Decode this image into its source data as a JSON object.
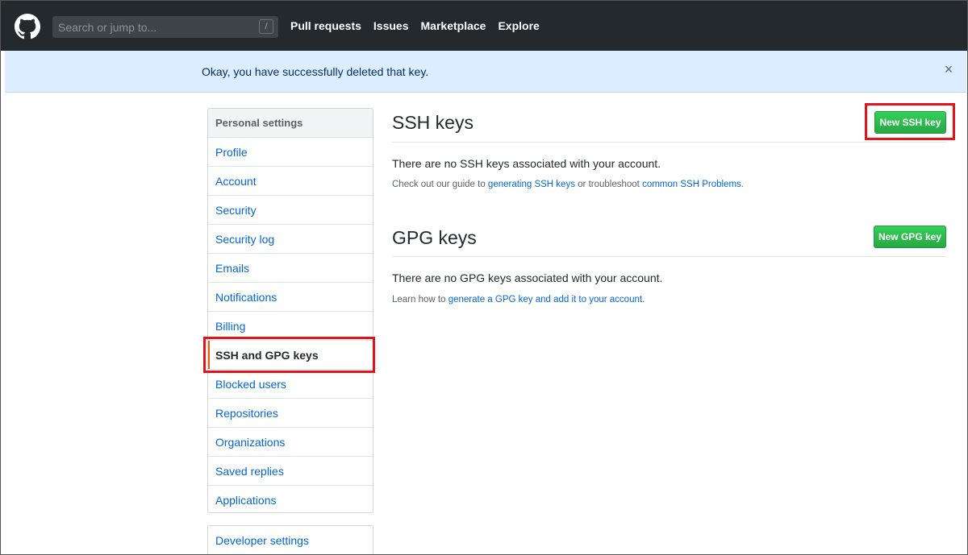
{
  "header": {
    "search_placeholder": "Search or jump to...",
    "search_shortcut": "/",
    "nav": [
      "Pull requests",
      "Issues",
      "Marketplace",
      "Explore"
    ]
  },
  "flash": {
    "message": "Okay, you have successfully deleted that key.",
    "close": "×"
  },
  "sidebar": {
    "heading": "Personal settings",
    "items": [
      {
        "label": "Profile"
      },
      {
        "label": "Account"
      },
      {
        "label": "Security"
      },
      {
        "label": "Security log"
      },
      {
        "label": "Emails"
      },
      {
        "label": "Notifications"
      },
      {
        "label": "Billing"
      },
      {
        "label": "SSH and GPG keys",
        "selected": true
      },
      {
        "label": "Blocked users"
      },
      {
        "label": "Repositories"
      },
      {
        "label": "Organizations"
      },
      {
        "label": "Saved replies"
      },
      {
        "label": "Applications"
      }
    ],
    "developer": "Developer settings"
  },
  "ssh": {
    "title": "SSH keys",
    "button": "New SSH key",
    "empty": "There are no SSH keys associated with your account.",
    "note_prefix": "Check out our guide to ",
    "link1": "generating SSH keys",
    "note_middle": " or troubleshoot ",
    "link2": "common SSH Problems",
    "note_suffix": "."
  },
  "gpg": {
    "title": "GPG keys",
    "button": "New GPG key",
    "empty": "There are no GPG keys associated with your account.",
    "note_prefix": "Learn how to ",
    "link": "generate a GPG key and add it to your account",
    "note_suffix": "."
  },
  "colors": {
    "header_bg": "#24292e",
    "flash_bg": "#dbedff",
    "link": "#0366d6",
    "green_button": "#28a745",
    "annotation_red": "#e3121b",
    "selected_marker": "#e36209"
  }
}
